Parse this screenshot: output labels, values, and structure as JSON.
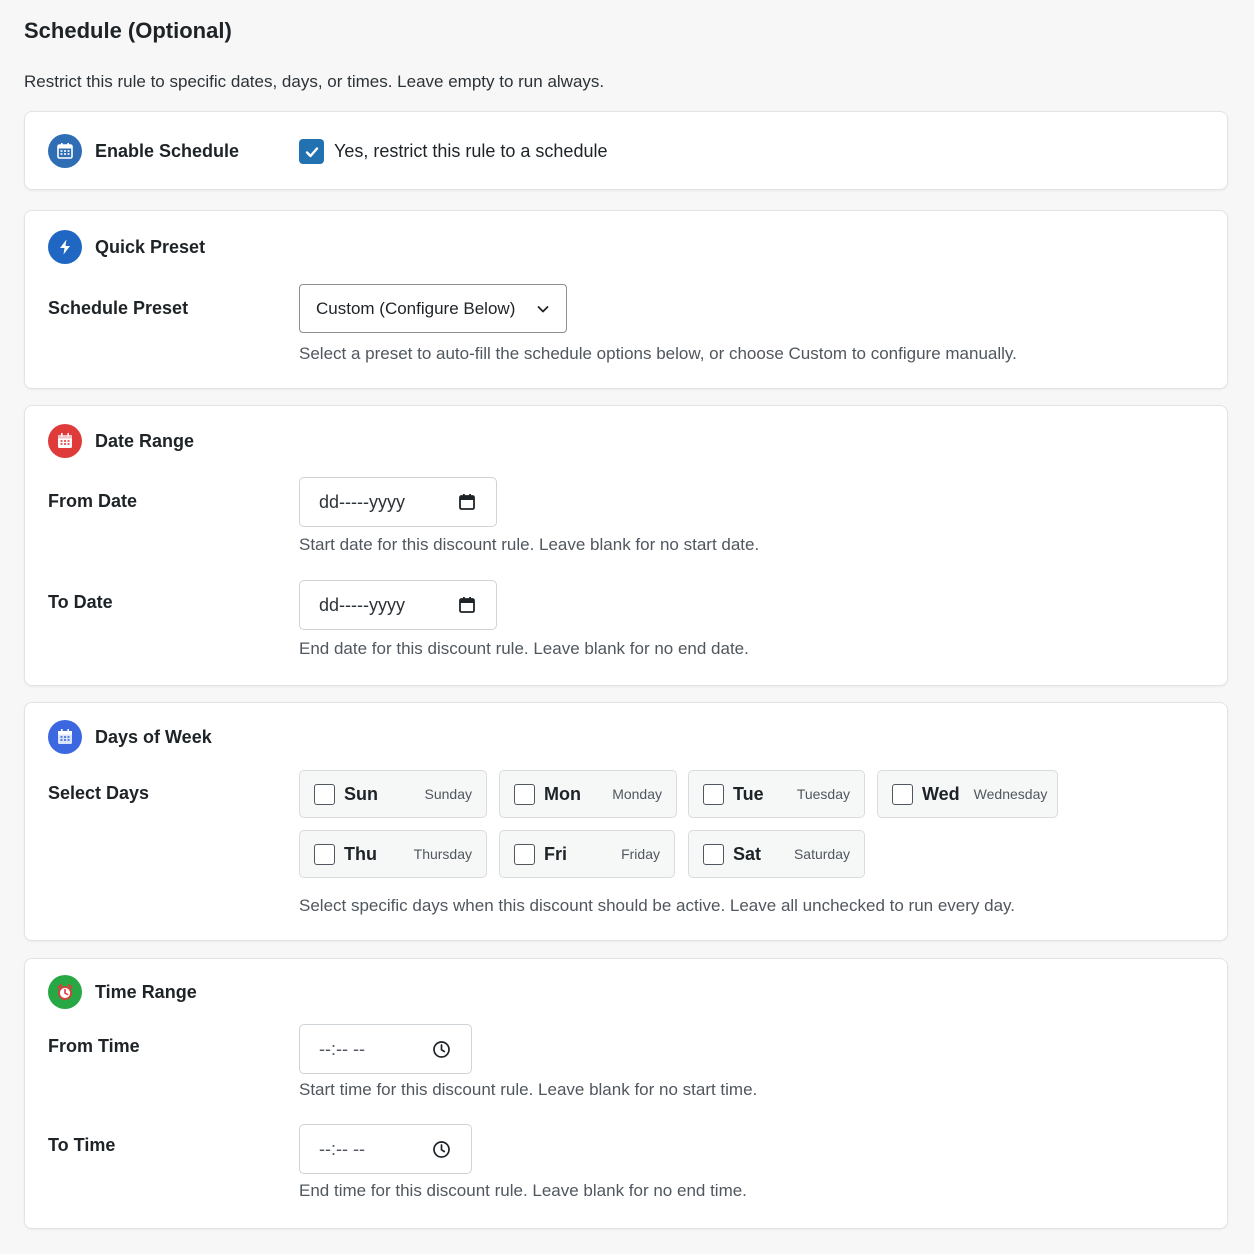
{
  "page": {
    "title": "Schedule (Optional)",
    "description": "Restrict this rule to specific dates, days, or times. Leave empty to run always."
  },
  "enable": {
    "title": "Enable Schedule",
    "icon": "calendar-icon",
    "icon_color": "#2f6db5",
    "checkbox_label": "Yes, restrict this rule to a schedule",
    "checked": true
  },
  "preset": {
    "title": "Quick Preset",
    "icon": "lightning-icon",
    "icon_color": "#1f67c2",
    "label": "Schedule Preset",
    "selected": "Custom (Configure Below)",
    "help": "Select a preset to auto-fill the schedule options below, or choose Custom to configure manually."
  },
  "date_range": {
    "title": "Date Range",
    "icon": "calendar-icon",
    "icon_color": "#e03b3b",
    "from_label": "From Date",
    "from_placeholder": "dd-----yyyy",
    "from_help": "Start date for this discount rule. Leave blank for no start date.",
    "to_label": "To Date",
    "to_placeholder": "dd-----yyyy",
    "to_help": "End date for this discount rule. Leave blank for no end date."
  },
  "days": {
    "title": "Days of Week",
    "icon": "calendar-icon",
    "icon_color": "#3b67e0",
    "label": "Select Days",
    "items": [
      {
        "short": "Sun",
        "full": "Sunday",
        "checked": false
      },
      {
        "short": "Mon",
        "full": "Monday",
        "checked": false
      },
      {
        "short": "Tue",
        "full": "Tuesday",
        "checked": false
      },
      {
        "short": "Wed",
        "full": "Wednesday",
        "checked": false
      },
      {
        "short": "Thu",
        "full": "Thursday",
        "checked": false
      },
      {
        "short": "Fri",
        "full": "Friday",
        "checked": false
      },
      {
        "short": "Sat",
        "full": "Saturday",
        "checked": false
      }
    ],
    "help": "Select specific days when this discount should be active. Leave all unchecked to run every day."
  },
  "time_range": {
    "title": "Time Range",
    "icon": "alarm-clock-icon",
    "icon_color": "#28a745",
    "from_label": "From Time",
    "from_placeholder": "--:-- --",
    "from_help": "Start time for this discount rule. Leave blank for no start time.",
    "to_label": "To Time",
    "to_placeholder": "--:-- --",
    "to_help": "End time for this discount rule. Leave blank for no end time."
  }
}
